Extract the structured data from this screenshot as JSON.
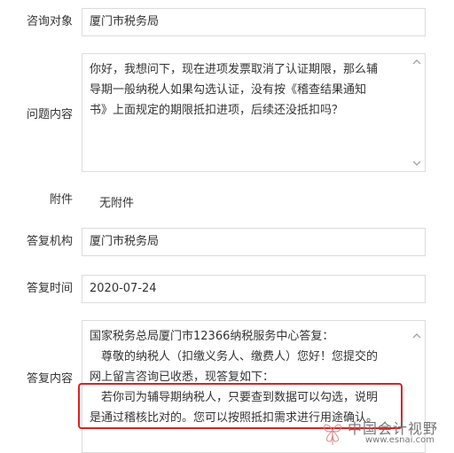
{
  "form": {
    "target": {
      "label": "咨询对象",
      "value": "厦门市税务局"
    },
    "question": {
      "label": "问题内容",
      "lines": [
        "你好，我想问下，现在进项发票取消了认证期限，那么辅",
        "导期一般纳税人如果勾选认证，没有按《稽查结果通知",
        "书》上面规定的期限抵扣进项，后续还没抵扣吗？"
      ]
    },
    "attachment": {
      "label": "附件",
      "value": "无附件"
    },
    "org": {
      "label": "答复机构",
      "value": "厦门市税务局"
    },
    "time": {
      "label": "答复时间",
      "value": "2020-07-24"
    },
    "answer": {
      "label": "答复内容",
      "lines": [
        "国家税务总局厦门市12366纳税服务中心答复：",
        "　尊敬的纳税人（扣缴义务人、缴费人）您好！您提交的",
        "网上留言咨询已收悉，现答复如下：",
        "　若你司为辅导期纳税人，只要查到数据可以勾选，说明",
        "是通过稽核比对的。您可以按照抵扣需求进行用途确认。"
      ]
    }
  },
  "watermark": {
    "title": "中国会计视野",
    "url": "www.esnai.com"
  },
  "colors": {
    "highlight": "#e02020",
    "border": "#dcdcdc",
    "text": "#333333"
  },
  "icons": [
    "scroll-up-arrow-icon",
    "scroll-down-arrow-icon",
    "flower-logo-icon"
  ]
}
